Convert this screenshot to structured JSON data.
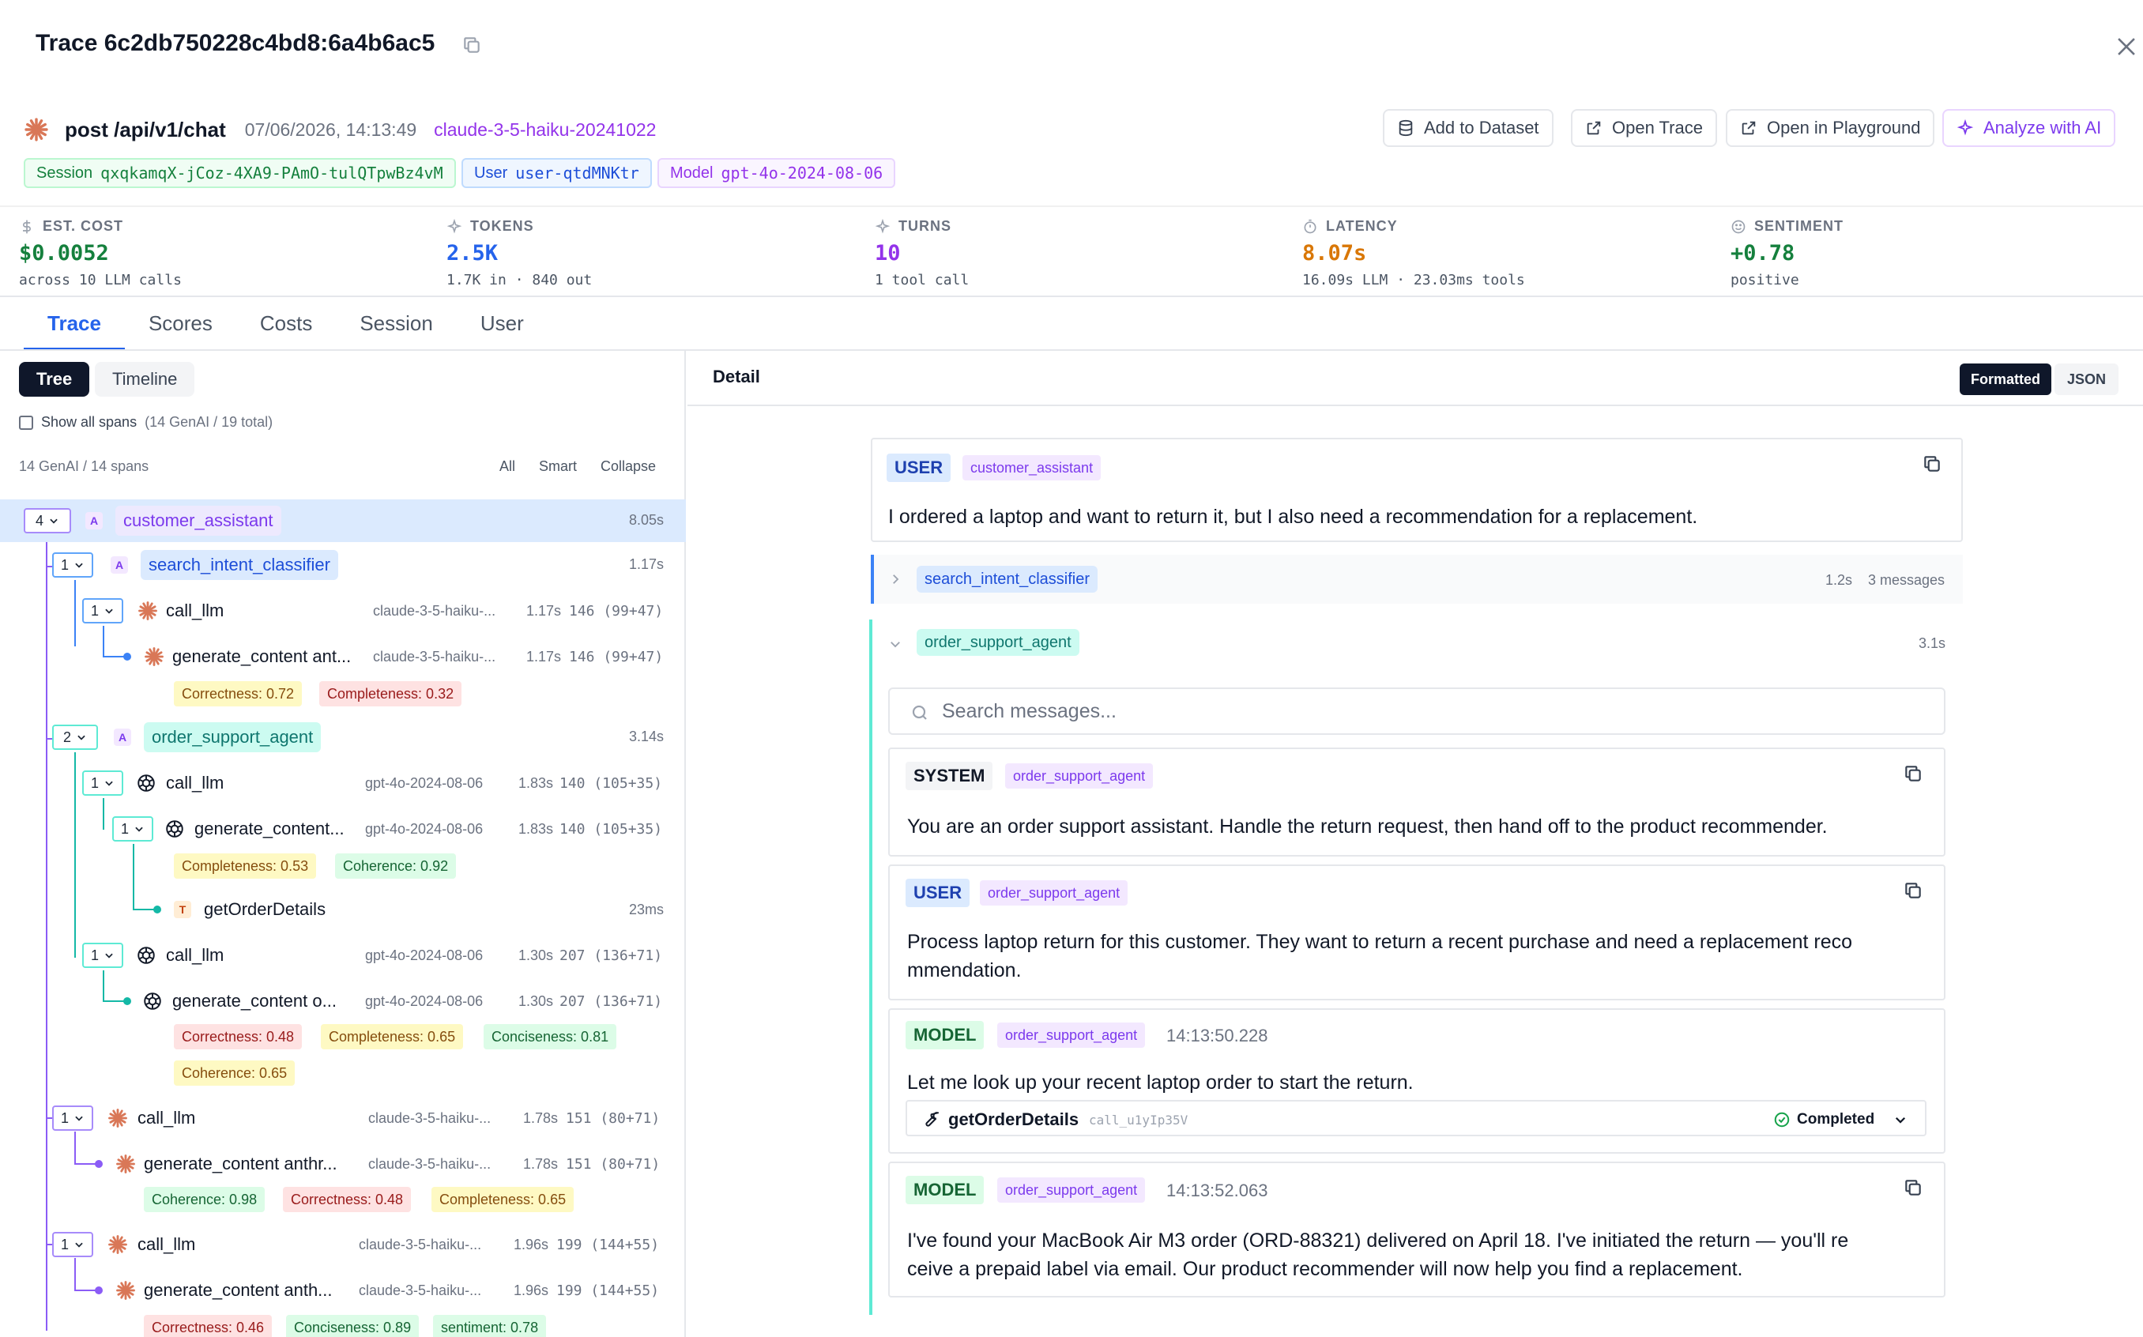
{
  "header": {
    "title": "Trace 6c2db750228c4bd8:6a4b6ac5",
    "route": "post /api/v1/chat",
    "timestamp": "07/06/2026, 14:13:49",
    "model_link": "claude-3-5-haiku-20241022",
    "actions": {
      "add_dataset": "Add to Dataset",
      "open_trace": "Open Trace",
      "open_playground": "Open in Playground",
      "analyze": "Analyze with AI"
    },
    "pills": {
      "session_key": "Session",
      "session_val": "qxqkamqX-jCoz-4XA9-PAmO-tulQTpwBz4vM",
      "user_key": "User",
      "user_val": "user-qtdMNKtr",
      "model_key": "Model",
      "model_val": "gpt-4o-2024-08-06"
    }
  },
  "metrics": [
    {
      "label": "EST. COST",
      "value": "$0.0052",
      "sub": "across 10 LLM calls",
      "color": "#15803d"
    },
    {
      "label": "TOKENS",
      "value": "2.5K",
      "sub": "1.7K in · 840 out",
      "color": "#2563eb"
    },
    {
      "label": "TURNS",
      "value": "10",
      "sub": "1 tool call",
      "color": "#9333ea"
    },
    {
      "label": "LATENCY",
      "value": "8.07s",
      "sub": "16.09s LLM · 23.03ms tools",
      "color": "#d97706"
    },
    {
      "label": "SENTIMENT",
      "value": "+0.78",
      "sub": "positive",
      "color": "#15803d"
    }
  ],
  "tabs": [
    "Trace",
    "Scores",
    "Costs",
    "Session",
    "User"
  ],
  "left": {
    "seg_tree": "Tree",
    "seg_timeline": "Timeline",
    "show_all": "Show all spans",
    "show_all_hint": "(14 GenAI / 19 total)",
    "span_count": "14 GenAI / 14 spans",
    "links": [
      "All",
      "Smart",
      "Collapse"
    ],
    "rows": {
      "r1": {
        "count": "4",
        "kind": "A",
        "name": "customer_assistant",
        "lat": "8.05s"
      },
      "r2": {
        "count": "1",
        "kind": "A",
        "name": "search_intent_classifier",
        "lat": "1.17s"
      },
      "r3": {
        "count": "1",
        "name": "call_llm",
        "model": "claude-3-5-haiku-...",
        "lat": "1.17s",
        "tok": "146  (99+47)"
      },
      "r4": {
        "name": "generate_content ant...",
        "model": "claude-3-5-haiku-...",
        "lat": "1.17s",
        "tok": "146  (99+47)",
        "scores": [
          "Correctness: 0.72",
          "Completeness: 0.32"
        ]
      },
      "r5": {
        "count": "2",
        "kind": "A",
        "name": "order_support_agent",
        "lat": "3.14s"
      },
      "r6": {
        "count": "1",
        "name": "call_llm",
        "model": "gpt-4o-2024-08-06",
        "lat": "1.83s",
        "tok": "140  (105+35)"
      },
      "r7": {
        "count": "1",
        "name": "generate_content...",
        "model": "gpt-4o-2024-08-06",
        "lat": "1.83s",
        "tok": "140  (105+35)",
        "scores": [
          "Completeness: 0.53",
          "Coherence: 0.92"
        ]
      },
      "r8": {
        "kind": "T",
        "name": "getOrderDetails",
        "lat": "23ms"
      },
      "r9": {
        "count": "1",
        "name": "call_llm",
        "model": "gpt-4o-2024-08-06",
        "lat": "1.30s",
        "tok": "207  (136+71)"
      },
      "r10": {
        "name": "generate_content o...",
        "model": "gpt-4o-2024-08-06",
        "lat": "1.30s",
        "tok": "207  (136+71)",
        "scores": [
          "Correctness: 0.48",
          "Completeness: 0.65",
          "Conciseness: 0.81",
          "Coherence: 0.65"
        ]
      },
      "r11": {
        "count": "1",
        "name": "call_llm",
        "model": "claude-3-5-haiku-...",
        "lat": "1.78s",
        "tok": "151  (80+71)"
      },
      "r12": {
        "name": "generate_content anthr...",
        "model": "claude-3-5-haiku-...",
        "lat": "1.78s",
        "tok": "151  (80+71)",
        "scores": [
          "Coherence: 0.98",
          "Correctness: 0.48",
          "Completeness: 0.65"
        ]
      },
      "r13": {
        "count": "1",
        "name": "call_llm",
        "model": "claude-3-5-haiku-...",
        "lat": "1.96s",
        "tok": "199  (144+55)"
      },
      "r14": {
        "name": "generate_content anth...",
        "model": "claude-3-5-haiku-...",
        "lat": "1.96s",
        "tok": "199  (144+55)",
        "scores": [
          "Correctness: 0.46",
          "Conciseness: 0.89",
          "sentiment: 0.78"
        ]
      }
    }
  },
  "detail": {
    "title": "Detail",
    "fmt_formatted": "Formatted",
    "fmt_json": "JSON",
    "user_msg": {
      "role": "USER",
      "agent": "customer_assistant",
      "text": "I ordered a laptop and want to return it, but I also need a recommendation for a replacement."
    },
    "section1": {
      "name": "search_intent_classifier",
      "dur": "1.2s",
      "count": "3 messages"
    },
    "section2": {
      "name": "order_support_agent",
      "dur": "3.1s"
    },
    "search_placeholder": "Search messages...",
    "system_msg": {
      "role": "SYSTEM",
      "agent": "order_support_agent",
      "text": "You are an order support assistant. Handle the return request, then hand off to the product recommender."
    },
    "user_msg2": {
      "role": "USER",
      "agent": "order_support_agent",
      "text1": "Process laptop return for this customer. They want to return a recent purchase and need a replacement reco",
      "text2": "mmendation."
    },
    "model_msg1": {
      "role": "MODEL",
      "agent": "order_support_agent",
      "time": "14:13:50.228",
      "text": "Let me look up your recent laptop order to start the return."
    },
    "tool_call": {
      "name": "getOrderDetails",
      "id": "call_u1yIp35V",
      "status": "Completed"
    },
    "model_msg2": {
      "role": "MODEL",
      "agent": "order_support_agent",
      "time": "14:13:52.063",
      "text1": "I've found your MacBook Air M3 order (ORD-88321) delivered on April 18. I've initiated the return — you'll re",
      "text2": "ceive a prepaid label via email. Our product recommender will now help you find a replacement."
    }
  },
  "colors": {
    "accent_blue": "#2563eb",
    "anthropic": "#d97757",
    "tree_line_blue": "#3b82f6",
    "tree_line_teal": "#14b8a6",
    "tree_line_violet": "#8b5cf6"
  }
}
